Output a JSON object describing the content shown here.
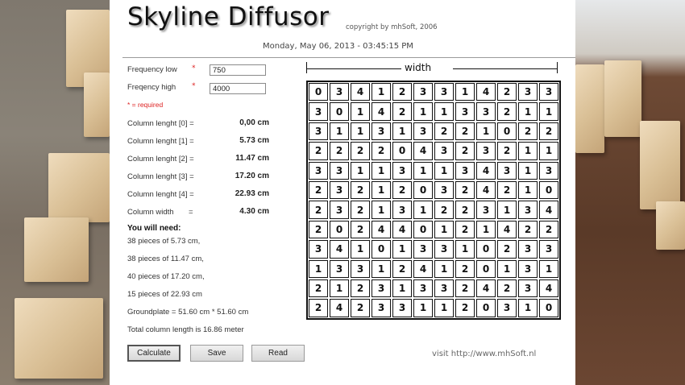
{
  "app": {
    "title": "Skyline Diffusor",
    "copyright": "copyright by mhSoft, 2006",
    "datetime": "Monday, May 06, 2013 - 03:45:15 PM"
  },
  "inputs": {
    "freq_low_label": "Frequency low",
    "freq_low_value": "750",
    "freq_high_label": "Freqency high",
    "freq_high_value": "4000",
    "required_star": "*",
    "required_note": "* = required"
  },
  "columns": [
    {
      "label": "Column lenght [0] =",
      "value": "0,00 cm"
    },
    {
      "label": "Column lenght [1] =",
      "value": "5.73 cm"
    },
    {
      "label": "Column lenght [2] =",
      "value": "11.47 cm"
    },
    {
      "label": "Column lenght [3] =",
      "value": "17.20 cm"
    },
    {
      "label": "Column lenght [4] =",
      "value": "22.93 cm"
    },
    {
      "label": "Column width",
      "eq": "=",
      "value": "4.30 cm"
    }
  ],
  "needs": {
    "title": "You will need:",
    "lines": [
      "38 pieces of  5.73 cm,",
      "38 pieces of  11.47 cm,",
      "40 pieces of  17.20 cm,",
      "15 pieces of  22.93 cm",
      "Groundplate = 51.60 cm * 51.60 cm",
      "Total column length is 16.86 meter"
    ]
  },
  "buttons": {
    "calculate": "Calculate",
    "save": "Save",
    "read": "Read"
  },
  "footer": {
    "visit": "visit http://www.mhSoft.nl"
  },
  "grid": {
    "header": "width",
    "rows": [
      [
        0,
        3,
        4,
        1,
        2,
        3,
        3,
        1,
        4,
        2,
        3,
        3
      ],
      [
        3,
        0,
        1,
        4,
        2,
        1,
        1,
        3,
        3,
        2,
        1,
        1
      ],
      [
        3,
        1,
        1,
        3,
        1,
        3,
        2,
        2,
        1,
        0,
        2,
        2
      ],
      [
        2,
        2,
        2,
        2,
        0,
        4,
        3,
        2,
        3,
        2,
        1,
        1
      ],
      [
        3,
        3,
        1,
        1,
        3,
        1,
        1,
        3,
        4,
        3,
        1,
        3
      ],
      [
        2,
        3,
        2,
        1,
        2,
        0,
        3,
        2,
        4,
        2,
        1,
        0
      ],
      [
        2,
        3,
        2,
        1,
        3,
        1,
        2,
        2,
        3,
        1,
        3,
        4
      ],
      [
        2,
        0,
        2,
        4,
        4,
        0,
        1,
        2,
        1,
        4,
        2,
        2
      ],
      [
        3,
        4,
        1,
        0,
        1,
        3,
        3,
        1,
        0,
        2,
        3,
        3
      ],
      [
        1,
        3,
        3,
        1,
        2,
        4,
        1,
        2,
        0,
        1,
        3,
        1
      ],
      [
        2,
        1,
        2,
        3,
        1,
        3,
        3,
        2,
        4,
        2,
        3,
        4
      ],
      [
        2,
        4,
        2,
        3,
        3,
        1,
        1,
        2,
        0,
        3,
        1,
        0
      ]
    ]
  }
}
